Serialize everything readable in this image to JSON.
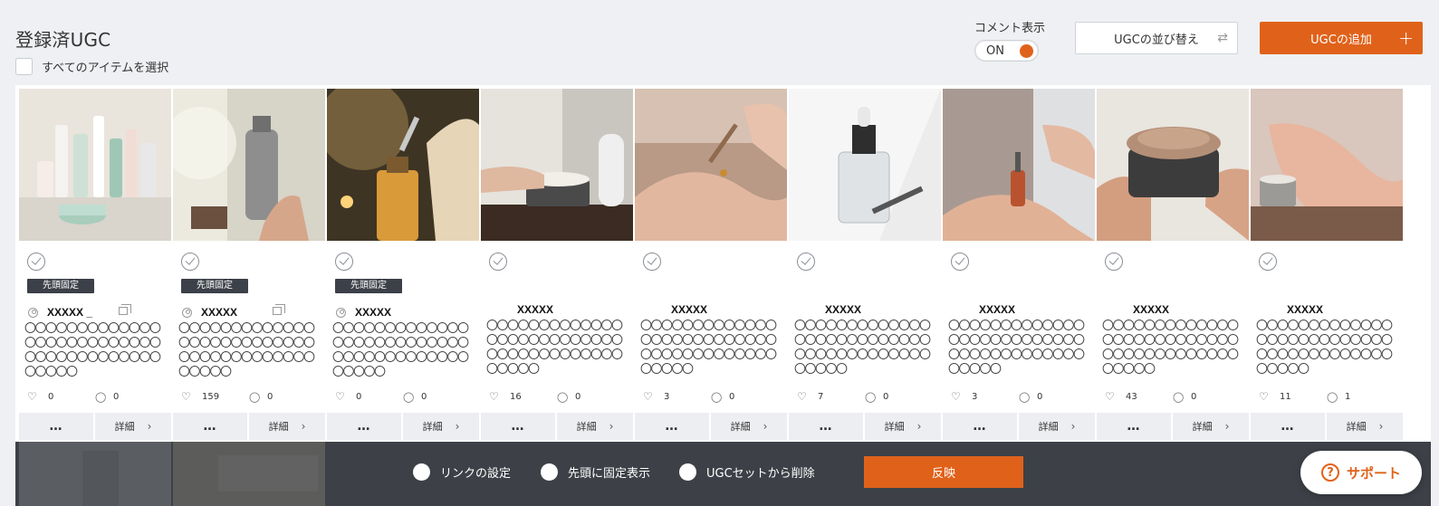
{
  "header": {
    "title": "登録済UGC",
    "select_all_label": "すべてのアイテムを選択",
    "comment_toggle_label": "コメント表示",
    "comment_toggle_value": "ON",
    "sort_button_label": "UGCの並び替え",
    "add_button_label": "UGCの追加"
  },
  "colors": {
    "accent": "#e0621a",
    "bar_dark": "#3d4147",
    "badge_dark": "#3c4048"
  },
  "cards": [
    {
      "pinned": true,
      "pin_label": "先頭固定",
      "username": "XXXXX _",
      "multi": true,
      "caption": "〇〇〇〇〇〇〇〇〇〇〇〇〇〇〇〇〇〇〇〇〇〇〇〇〇〇〇〇〇〇〇〇〇〇〇〇〇〇〇〇〇〇〇〇",
      "likes": "0",
      "comments": "0",
      "more_label": "…",
      "detail_label": "詳細",
      "image": "cosmetics-bottles"
    },
    {
      "pinned": true,
      "pin_label": "先頭固定",
      "username": "XXXXX",
      "multi": true,
      "caption": "〇〇〇〇〇〇〇〇〇〇〇〇〇〇〇〇〇〇〇〇〇〇〇〇〇〇〇〇〇〇〇〇〇〇〇〇〇〇〇〇〇〇〇〇",
      "likes": "159",
      "comments": "0",
      "more_label": "…",
      "detail_label": "詳細",
      "image": "spray-bottle"
    },
    {
      "pinned": true,
      "pin_label": "先頭固定",
      "username": "XXXXX",
      "multi": false,
      "caption": "〇〇〇〇〇〇〇〇〇〇〇〇〇〇〇〇〇〇〇〇〇〇〇〇〇〇〇〇〇〇〇〇〇〇〇〇〇〇〇〇〇〇〇〇",
      "likes": "0",
      "comments": "0",
      "more_label": "…",
      "detail_label": "詳細",
      "image": "oil-dropper"
    },
    {
      "pinned": false,
      "username": "XXXXX",
      "caption": "〇〇〇〇〇〇〇〇〇〇〇〇〇〇〇〇〇〇〇〇〇〇〇〇〇〇〇〇〇〇〇〇〇〇〇〇〇〇〇〇〇〇〇〇",
      "likes": "16",
      "comments": "0",
      "more_label": "…",
      "detail_label": "詳細",
      "image": "cream-jar"
    },
    {
      "pinned": false,
      "username": "XXXXX",
      "caption": "〇〇〇〇〇〇〇〇〇〇〇〇〇〇〇〇〇〇〇〇〇〇〇〇〇〇〇〇〇〇〇〇〇〇〇〇〇〇〇〇〇〇〇〇",
      "likes": "3",
      "comments": "0",
      "more_label": "…",
      "detail_label": "詳細",
      "image": "hand-dropper"
    },
    {
      "pinned": false,
      "username": "XXXXX",
      "caption": "〇〇〇〇〇〇〇〇〇〇〇〇〇〇〇〇〇〇〇〇〇〇〇〇〇〇〇〇〇〇〇〇〇〇〇〇〇〇〇〇〇〇〇〇",
      "likes": "7",
      "comments": "0",
      "more_label": "…",
      "detail_label": "詳細",
      "image": "serum-bottle"
    },
    {
      "pinned": false,
      "username": "XXXXX",
      "caption": "〇〇〇〇〇〇〇〇〇〇〇〇〇〇〇〇〇〇〇〇〇〇〇〇〇〇〇〇〇〇〇〇〇〇〇〇〇〇〇〇〇〇〇〇",
      "likes": "3",
      "comments": "0",
      "more_label": "…",
      "detail_label": "詳細",
      "image": "palm-dropper"
    },
    {
      "pinned": false,
      "username": "XXXXX",
      "caption": "〇〇〇〇〇〇〇〇〇〇〇〇〇〇〇〇〇〇〇〇〇〇〇〇〇〇〇〇〇〇〇〇〇〇〇〇〇〇〇〇〇〇〇〇",
      "likes": "43",
      "comments": "0",
      "more_label": "…",
      "detail_label": "詳細",
      "image": "scrub-jar"
    },
    {
      "pinned": false,
      "username": "XXXXX",
      "caption": "〇〇〇〇〇〇〇〇〇〇〇〇〇〇〇〇〇〇〇〇〇〇〇〇〇〇〇〇〇〇〇〇〇〇〇〇〇〇〇〇〇〇〇〇",
      "likes": "11",
      "comments": "1",
      "more_label": "…",
      "detail_label": "詳細",
      "image": "hand-cream"
    }
  ],
  "bottom_bar": {
    "options": [
      "リンクの設定",
      "先頭に固定表示",
      "UGCセットから削除"
    ],
    "apply_label": "反映"
  },
  "support": {
    "label": "サポート",
    "help_glyph": "?"
  }
}
